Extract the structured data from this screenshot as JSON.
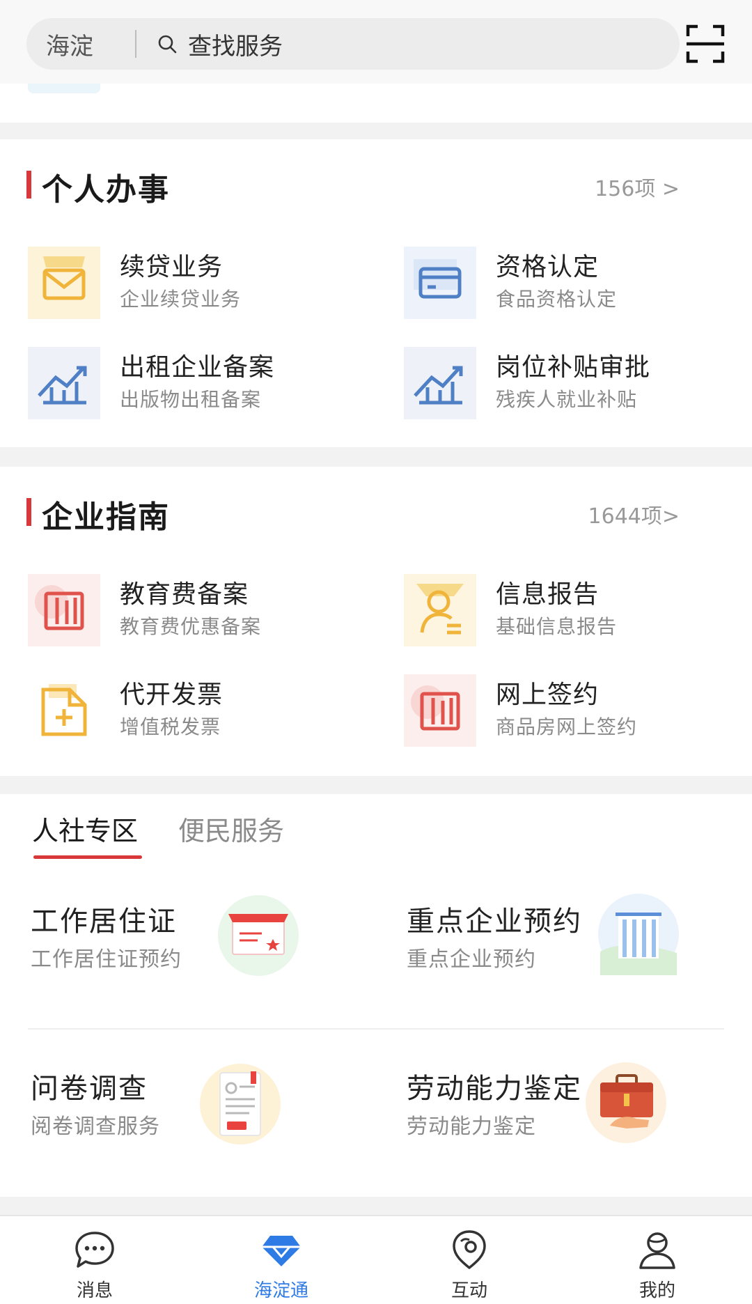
{
  "header": {
    "district": "海淀",
    "search_placeholder": "查找服务",
    "icons": {
      "search": "search-icon",
      "scan": "scan-icon"
    }
  },
  "personal": {
    "title": "个人办事",
    "count": "156项 >",
    "items": [
      {
        "title": "续贷业务",
        "subtitle": "企业续贷业务",
        "icon": "envelope-icon"
      },
      {
        "title": "资格认定",
        "subtitle": "食品资格认定",
        "icon": "card-icon"
      },
      {
        "title": "出租企业备案",
        "subtitle": "出版物出租备案",
        "icon": "chart-up-icon"
      },
      {
        "title": "岗位补贴审批",
        "subtitle": "残疾人就业补贴",
        "icon": "chart-up-icon"
      }
    ]
  },
  "enterprise": {
    "title": "企业指南",
    "count": "1644项>",
    "items": [
      {
        "title": "教育费备案",
        "subtitle": "教育费优惠备案",
        "icon": "book-icon"
      },
      {
        "title": "信息报告",
        "subtitle": "基础信息报告",
        "icon": "person-report-icon"
      },
      {
        "title": "代开发票",
        "subtitle": "增值税发票",
        "icon": "invoice-add-icon"
      },
      {
        "title": "网上签约",
        "subtitle": "商品房网上签约",
        "icon": "book-icon"
      }
    ]
  },
  "tabs": {
    "active": "人社专区",
    "inactive": "便民服务",
    "items": [
      {
        "title": "工作居住证",
        "subtitle": "工作居住证预约",
        "icon": "certificate-icon"
      },
      {
        "title": "重点企业预约",
        "subtitle": "重点企业预约",
        "icon": "building-icon"
      },
      {
        "title": "问卷调查",
        "subtitle": "阅卷调查服务",
        "icon": "form-icon"
      },
      {
        "title": "劳动能力鉴定",
        "subtitle": "劳动能力鉴定",
        "icon": "briefcase-icon"
      }
    ]
  },
  "bottom_nav": [
    {
      "label": "消息",
      "icon": "message-icon",
      "active": false
    },
    {
      "label": "海淀通",
      "icon": "diamond-icon",
      "active": true
    },
    {
      "label": "互动",
      "icon": "location-chat-icon",
      "active": false
    },
    {
      "label": "我的",
      "icon": "user-icon",
      "active": false
    }
  ],
  "colors": {
    "accent": "#d9383a",
    "nav_active": "#2f7be5"
  }
}
